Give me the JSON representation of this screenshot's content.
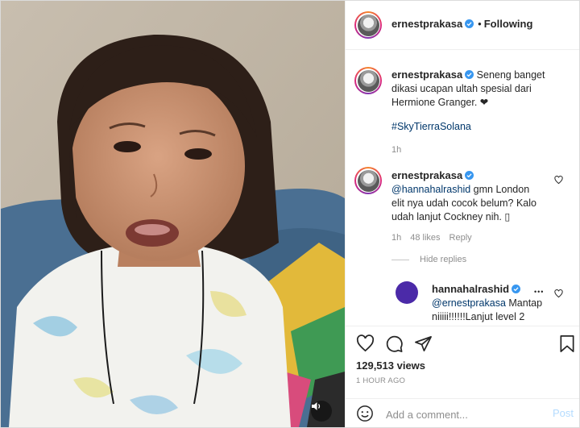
{
  "header": {
    "username": "ernestprakasa",
    "separator": "•",
    "follow_label": "Following"
  },
  "caption": {
    "username": "ernestprakasa",
    "text_line1": "Seneng banget",
    "text_line2": "dikasi ucapan ultah spesial dari",
    "text_line3": "Hermione Granger. ❤",
    "hashtag": "#SkyTierraSolana",
    "age": "1h"
  },
  "comment": {
    "username": "ernestprakasa",
    "mention": "@hannahalrashid",
    "text_a": " gmn London",
    "text_b": "elit nya udah cocok belum? Kalo",
    "text_c": "udah lanjut Cockney nih. ▯",
    "age": "1h",
    "likes": "48 likes",
    "reply_label": "Reply",
    "hide_replies_label": "Hide replies"
  },
  "reply": {
    "username": "hannahalrashid",
    "mention": "@ernestprakasa",
    "text_a": " Mantap",
    "text_b": "niiiii!!!!!!Lanjut level 2",
    "more": "•••",
    "avatar_color": "#4b2aa8"
  },
  "stats": {
    "views": "129,513 views",
    "time": "1 HOUR AGO"
  },
  "composer": {
    "placeholder": "Add a comment...",
    "post_label": "Post"
  },
  "colors": {
    "verified": "#3897f0",
    "link": "#00376b",
    "muted": "#8e8e8e",
    "post_disabled": "#b3dbff"
  },
  "icons": [
    "verified-badge-icon",
    "heart-icon",
    "comment-icon",
    "share-icon",
    "bookmark-icon",
    "emoji-icon",
    "sound-icon"
  ]
}
